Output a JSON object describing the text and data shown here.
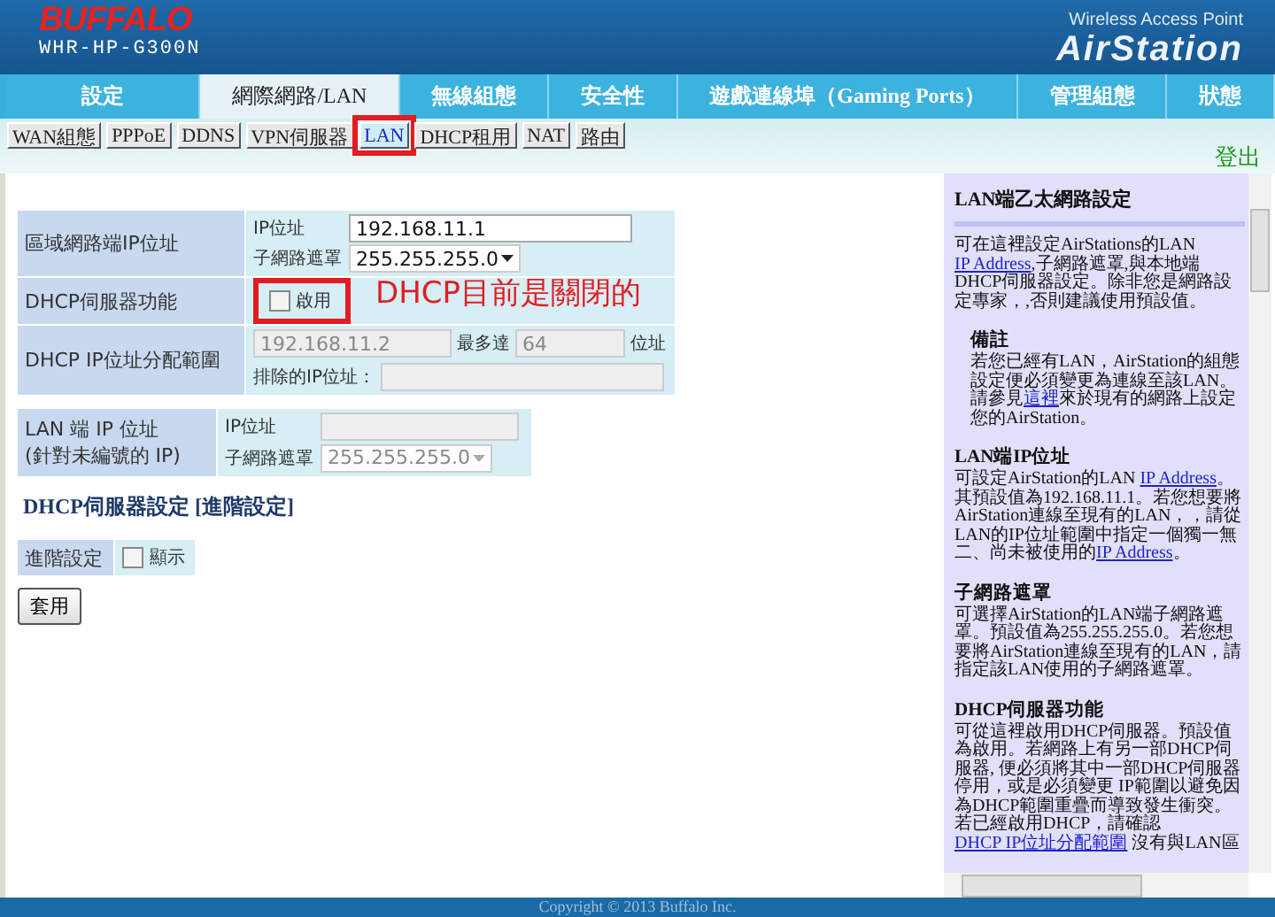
{
  "header": {
    "brand": "BUFFALO",
    "model": "WHR-HP-G300N",
    "product_line": "Wireless Access Point",
    "product": "AirStation"
  },
  "tabs": [
    {
      "label": "設定",
      "selected": false
    },
    {
      "label": "網際網路/LAN",
      "selected": true
    },
    {
      "label": "無線組態",
      "selected": false
    },
    {
      "label": "安全性",
      "selected": false
    },
    {
      "label": "遊戲連線埠（Gaming Ports）",
      "selected": false
    },
    {
      "label": "管理組態",
      "selected": false
    },
    {
      "label": "狀態",
      "selected": false
    }
  ],
  "subtabs": [
    {
      "label": "WAN組態",
      "selected": false,
      "highlighted": false
    },
    {
      "label": "PPPoE",
      "selected": false,
      "highlighted": false
    },
    {
      "label": "DDNS",
      "selected": false,
      "highlighted": false
    },
    {
      "label": "VPN伺服器",
      "selected": false,
      "highlighted": false
    },
    {
      "label": "LAN",
      "selected": true,
      "highlighted": true
    },
    {
      "label": "DHCP租用",
      "selected": false,
      "highlighted": false
    },
    {
      "label": "NAT",
      "selected": false,
      "highlighted": false
    },
    {
      "label": "路由",
      "selected": false,
      "highlighted": false
    }
  ],
  "logout": "登出",
  "lan_table": {
    "rows": [
      {
        "label": "區域網路端IP位址",
        "ip_label": "IP位址",
        "ip_value": "192.168.11.1",
        "mask_label": "子網路遮罩",
        "mask_value": "255.255.255.0"
      },
      {
        "label": "DHCP伺服器功能",
        "checkbox_label": "啟用",
        "checked": false,
        "highlighted": true
      },
      {
        "label": "DHCP IP位址分配範圍",
        "start_value": "192.168.11.2",
        "max_label": "最多達",
        "count_value": "64",
        "unit": "位址",
        "exclude_label": "排除的IP位址：",
        "disabled": true
      }
    ]
  },
  "annotation": "DHCP目前是關閉的",
  "unnumbered_table": {
    "label_line1": "LAN 端 IP 位址",
    "label_line2": "(針對未編號的 IP)",
    "ip_label": "IP位址",
    "mask_label": "子網路遮罩",
    "mask_value": "255.255.255.0",
    "disabled": true
  },
  "dhcp_heading": "DHCP伺服器設定 [進階設定]",
  "advanced": {
    "label": "進階設定",
    "checkbox_label": "顯示",
    "checked": false
  },
  "apply_button": "套用",
  "help": [
    {
      "kind": "title",
      "text": "LAN端乙太網路設定"
    },
    {
      "kind": "paragraph",
      "parts": [
        {
          "text": "可在這裡設定AirStations的LAN ",
          "kind": "text"
        },
        {
          "text": "IP Address",
          "kind": "link"
        },
        {
          "text": ",子網路遮罩,與本地端DHCP伺服器設定。除非您是網路設定專家，,否則建議使用預設值。",
          "kind": "text"
        }
      ]
    },
    {
      "kind": "note_heading",
      "text": "備註"
    },
    {
      "kind": "note",
      "parts": [
        {
          "text": "若您已經有LAN，AirStation的組態設定便必須變更為連線至該LAN。請參見",
          "kind": "text"
        },
        {
          "text": "這裡",
          "kind": "link"
        },
        {
          "text": "來於現有的網路上設定您的AirStation。",
          "kind": "text"
        }
      ]
    },
    {
      "kind": "heading",
      "text": "LAN端IP位址"
    },
    {
      "kind": "paragraph",
      "parts": [
        {
          "text": "可設定AirStation的LAN ",
          "kind": "text"
        },
        {
          "text": "IP Address",
          "kind": "link"
        },
        {
          "text": "。其預設值為192.168.11.1。若您想要將AirStation連線至現有的LAN，，請從LAN的IP位址範圍中指定一個獨一無二、尚未被使用的",
          "kind": "text"
        },
        {
          "text": "IP Address",
          "kind": "link"
        },
        {
          "text": "。",
          "kind": "text"
        }
      ]
    },
    {
      "kind": "heading",
      "text": "子網路遮罩"
    },
    {
      "kind": "paragraph",
      "parts": [
        {
          "text": "可選擇AirStation的LAN端子網路遮罩。預設值為255.255.255.0。若您想要將AirStation連線至現有的LAN，請指定該LAN使用的子網路遮罩。",
          "kind": "text"
        }
      ]
    },
    {
      "kind": "heading",
      "text": "DHCP伺服器功能"
    },
    {
      "kind": "paragraph",
      "parts": [
        {
          "text": "可從這裡啟用DHCP伺服器。預設值為啟用。若網路上有另一部DHCP伺服器, 便必須將其中一部DHCP伺服器停用，或是必須變更 IP範圍以避免因為DHCP範圍重疊而導致發生衝突。若已經啟用DHCP，請確認",
          "kind": "text"
        },
        {
          "text": "DHCP IP位址分配範圍",
          "kind": "link"
        },
        {
          "text": " 沒有與LAN區",
          "kind": "text"
        }
      ]
    }
  ],
  "footer": "Copyright © 2013 Buffalo Inc."
}
